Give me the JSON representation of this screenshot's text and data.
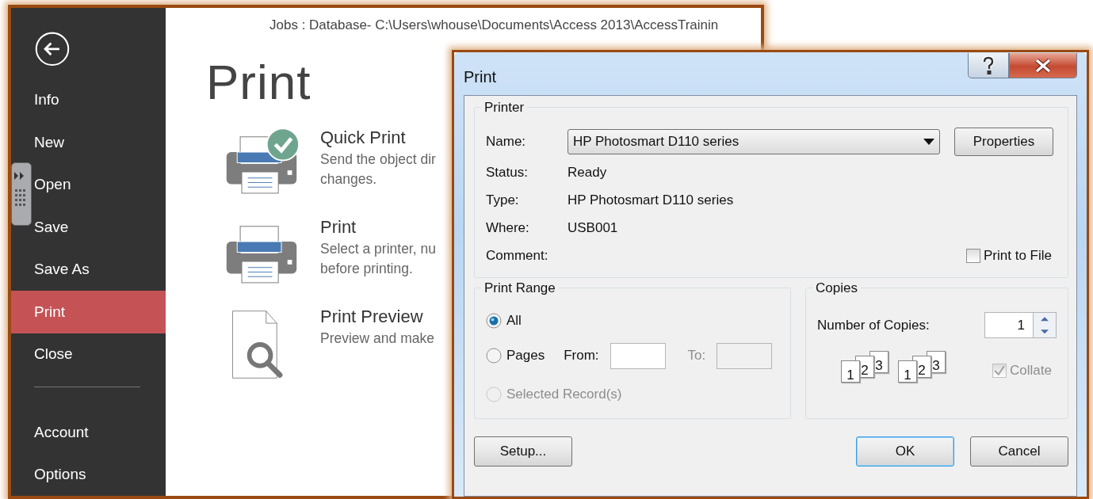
{
  "backstage": {
    "title": "Jobs : Database- C:\\Users\\whouse\\Documents\\Access 2013\\AccessTrainin",
    "nav": [
      {
        "label": "Info",
        "selected": false
      },
      {
        "label": "New",
        "selected": false
      },
      {
        "label": "Open",
        "selected": false
      },
      {
        "label": "Save",
        "selected": false
      },
      {
        "label": "Save As",
        "selected": false
      },
      {
        "label": "Print",
        "selected": true
      },
      {
        "label": "Close",
        "selected": false
      }
    ],
    "nav_bottom": [
      {
        "label": "Account",
        "selected": false
      },
      {
        "label": "Options",
        "selected": false
      }
    ],
    "heading": "Print",
    "options": [
      {
        "kind": "quick",
        "title": "Quick Print",
        "lines": [
          "Send the object dir",
          "changes."
        ]
      },
      {
        "kind": "print",
        "title": "Print",
        "lines": [
          "Select a printer, nu",
          "before printing."
        ]
      },
      {
        "kind": "preview",
        "title": "Print Preview",
        "lines": [
          "Preview and make"
        ]
      }
    ]
  },
  "dialog": {
    "title": "Print",
    "printer": {
      "legend": "Printer",
      "name_label": "Name:",
      "name_value": "HP Photosmart D110 series",
      "properties_button": "Properties",
      "rows": [
        {
          "label": "Status:",
          "value": "Ready"
        },
        {
          "label": "Type:",
          "value": "HP Photosmart D110 series"
        },
        {
          "label": "Where:",
          "value": "USB001"
        },
        {
          "label": "Comment:"
        }
      ],
      "print_to_file": {
        "label": "Print to File",
        "checked": false
      }
    },
    "print_range": {
      "legend": "Print Range",
      "options": [
        {
          "kind": "all",
          "label": "All",
          "selected": true,
          "disabled": false
        },
        {
          "kind": "pages",
          "label": "Pages",
          "selected": false,
          "disabled": false
        },
        {
          "kind": "records",
          "label": "Selected Record(s)",
          "selected": false,
          "disabled": true
        }
      ],
      "from_label": "From:",
      "to_label": "To:",
      "to_disabled": true
    },
    "copies": {
      "legend": "Copies",
      "number_label": "Number of Copies:",
      "number_value": "1",
      "stacks": [
        {
          "pages": [
            "1",
            "2",
            "3"
          ]
        },
        {
          "pages": [
            "1",
            "2",
            "3"
          ]
        }
      ],
      "collate": {
        "label": "Collate",
        "checked": true,
        "disabled": true
      }
    },
    "buttons": [
      {
        "label": "Setup...",
        "default": false
      },
      {
        "label": "OK",
        "default": true
      },
      {
        "label": "Cancel",
        "default": false
      }
    ]
  }
}
